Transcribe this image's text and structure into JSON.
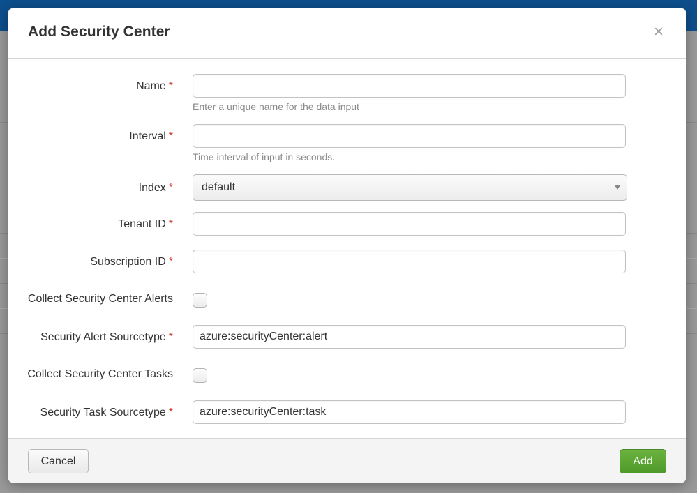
{
  "modal": {
    "title": "Add Security Center",
    "close_glyph": "×",
    "required_marker": "*"
  },
  "form": {
    "name": {
      "label": "Name",
      "value": "",
      "help": "Enter a unique name for the data input"
    },
    "interval": {
      "label": "Interval",
      "value": "",
      "help": "Time interval of input in seconds."
    },
    "index": {
      "label": "Index",
      "value": "default"
    },
    "tenant_id": {
      "label": "Tenant ID",
      "value": ""
    },
    "subscription_id": {
      "label": "Subscription ID",
      "value": ""
    },
    "collect_alerts": {
      "label": "Collect Security Center Alerts",
      "checked": false
    },
    "alert_sourcetype": {
      "label": "Security Alert Sourcetype",
      "value": "azure:securityCenter:alert"
    },
    "collect_tasks": {
      "label": "Collect Security Center Tasks",
      "checked": false
    },
    "task_sourcetype": {
      "label": "Security Task Sourcetype",
      "value": "azure:securityCenter:task"
    }
  },
  "footer": {
    "cancel_label": "Cancel",
    "add_label": "Add"
  },
  "colors": {
    "required": "#d0342c",
    "add_button": "#5aa531",
    "top_bar": "#0d4f8c"
  }
}
